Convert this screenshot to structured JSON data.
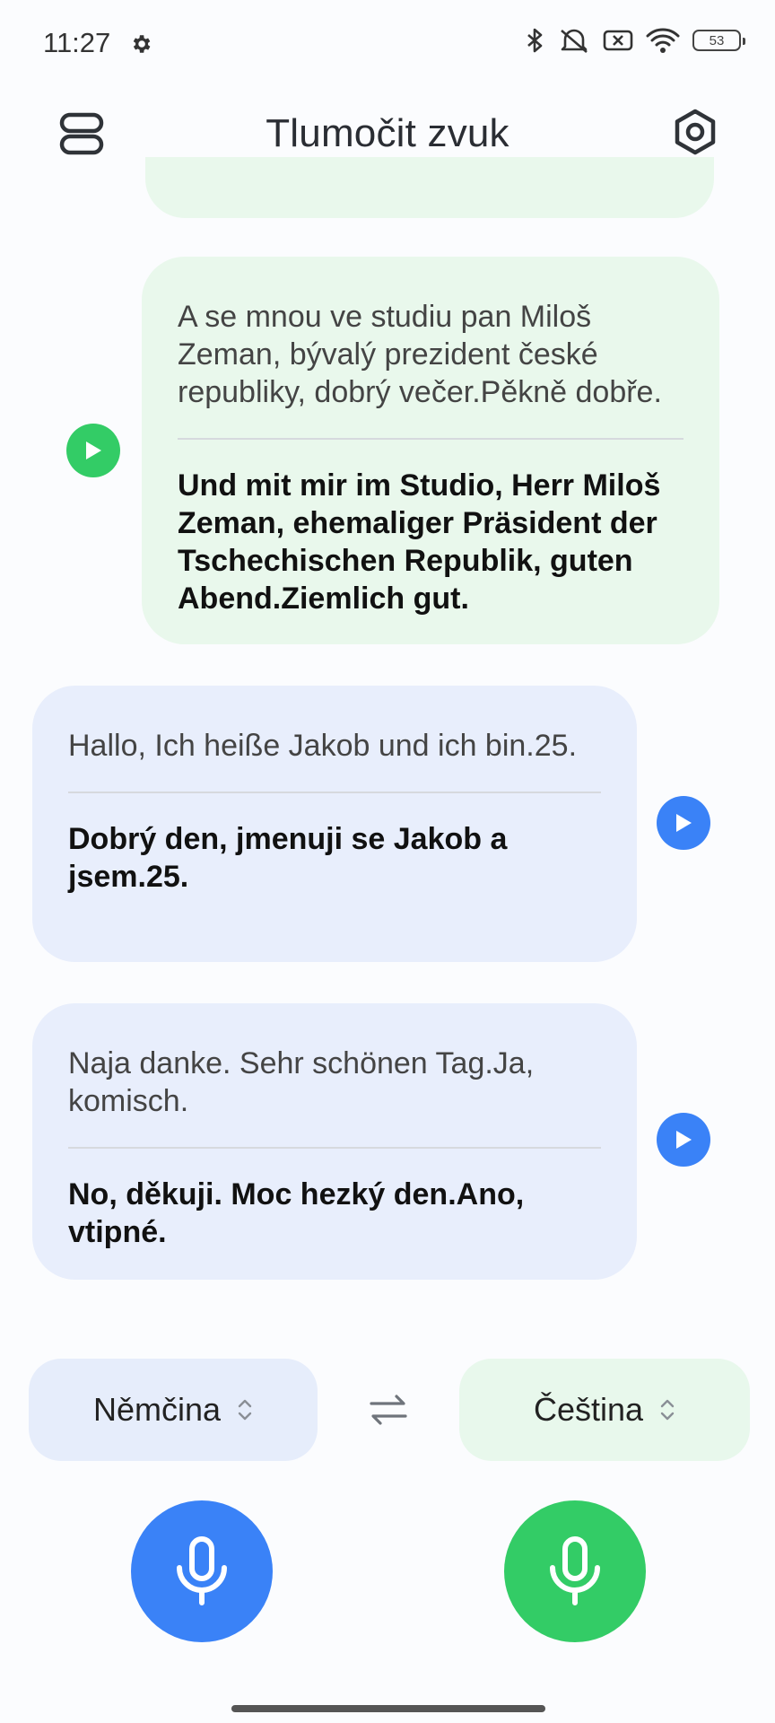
{
  "status_bar": {
    "time": "11:27",
    "battery": "53"
  },
  "header": {
    "title": "Tlumočit zvuk"
  },
  "conversation": [
    {
      "side": "right",
      "color": "green",
      "source": "A se mnou ve studiu pan Miloš Zeman, bývalý prezident české republiky, dobrý večer.Pěkně dobře.",
      "translation": "Und mit mir im Studio, Herr Miloš Zeman, ehemaliger Präsident der Tschechischen Republik, guten Abend.Ziemlich gut."
    },
    {
      "side": "left",
      "color": "blue",
      "source": "Hallo, Ich heiße Jakob und ich bin.25.",
      "translation": "Dobrý den, jmenuji se Jakob a jsem.25."
    },
    {
      "side": "left",
      "color": "blue",
      "source": "Naja danke. Sehr schönen Tag.Ja, komisch.",
      "translation": "No, děkuji. Moc hezký den.Ano, vtipné."
    }
  ],
  "languages": {
    "left": "Němčina",
    "right": "Čeština"
  },
  "colors": {
    "blue_accent": "#3a82f7",
    "green_accent": "#33cc66",
    "blue_bubble": "#e8eefc",
    "green_bubble": "#e9f8ec"
  }
}
